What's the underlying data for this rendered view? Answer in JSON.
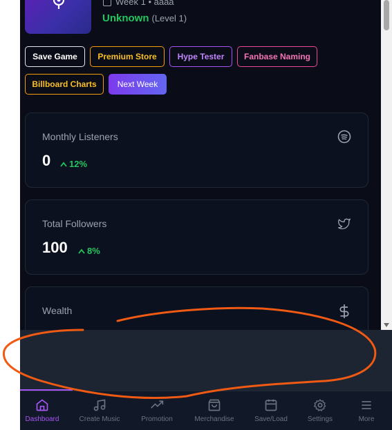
{
  "profile": {
    "week_text": "Week 1 • aaaa",
    "status_name": "Unknown",
    "status_level": "(Level 1)"
  },
  "actions": {
    "save_game": "Save Game",
    "premium_store": "Premium Store",
    "hype_tester": "Hype Tester",
    "fanbase_naming": "Fanbase Naming",
    "billboard_charts": "Billboard Charts",
    "next_week": "Next Week"
  },
  "stats": {
    "listeners": {
      "title": "Monthly Listeners",
      "value": "0",
      "change": "12%",
      "icon": "spotify-icon"
    },
    "followers": {
      "title": "Total Followers",
      "value": "100",
      "change": "8%",
      "icon": "twitter-icon"
    },
    "wealth": {
      "title": "Wealth",
      "icon": "dollar-icon"
    }
  },
  "nav": {
    "items": [
      {
        "label": "Dashboard",
        "icon": "home-icon"
      },
      {
        "label": "Create Music",
        "icon": "music-note-icon"
      },
      {
        "label": "Promotion",
        "icon": "trending-icon"
      },
      {
        "label": "Merchandise",
        "icon": "shopping-bag-icon"
      },
      {
        "label": "Save/Load",
        "icon": "calendar-icon"
      },
      {
        "label": "Settings",
        "icon": "gear-icon"
      },
      {
        "label": "More",
        "icon": "menu-icon"
      }
    ]
  },
  "colors": {
    "background": "#0a0d17",
    "accent": "#a855f7",
    "positive": "#22c55e",
    "gold": "#fbbf24",
    "pink": "#f472b6",
    "annotation": "#f05a13"
  }
}
